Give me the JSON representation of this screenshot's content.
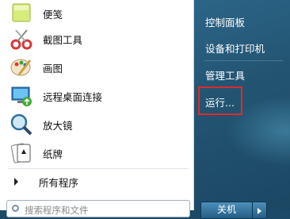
{
  "programs": [
    {
      "label": "便笺",
      "icon": "sticky-notes-icon"
    },
    {
      "label": "截图工具",
      "icon": "snipping-tool-icon"
    },
    {
      "label": "画图",
      "icon": "paint-icon"
    },
    {
      "label": "远程桌面连接",
      "icon": "remote-desktop-icon"
    },
    {
      "label": "放大镜",
      "icon": "magnifier-icon"
    },
    {
      "label": "纸牌",
      "icon": "solitaire-icon"
    }
  ],
  "all_programs_label": "所有程序",
  "search": {
    "placeholder": "搜索程序和文件"
  },
  "right": {
    "items": [
      "控制面板",
      "设备和打印机",
      "管理工具",
      "运行..."
    ]
  },
  "shutdown_label": "关机",
  "colors": {
    "highlight": "#e02a2a",
    "pane_blue": "#235573"
  }
}
